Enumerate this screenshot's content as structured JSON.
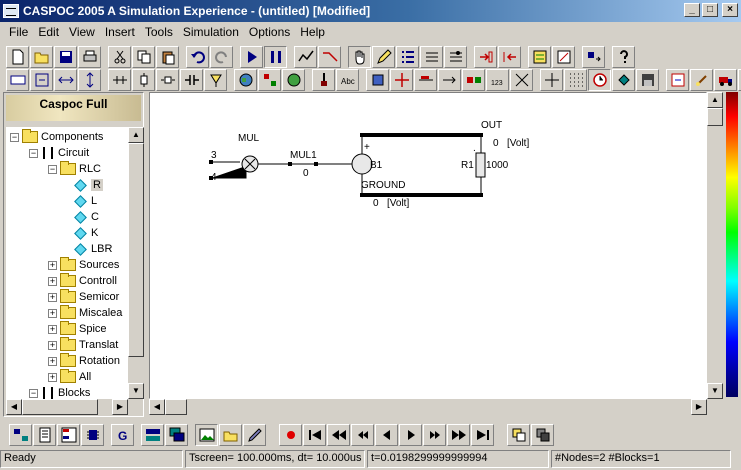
{
  "window": {
    "title": "CASPOC 2005 A Simulation Experience - (untitled) [Modified]",
    "minimize": "_",
    "maximize": "□",
    "close": "×"
  },
  "menu": [
    "File",
    "Edit",
    "View",
    "Insert",
    "Tools",
    "Simulation",
    "Options",
    "Help"
  ],
  "panel": {
    "title": "Caspoc Full"
  },
  "tree": [
    {
      "label": "Components",
      "level": 0,
      "toggle": "−",
      "icon": "folder"
    },
    {
      "label": "Circuit",
      "level": 1,
      "toggle": "−",
      "icon": "component"
    },
    {
      "label": "RLC",
      "level": 2,
      "toggle": "−",
      "icon": "folder"
    },
    {
      "label": "R",
      "level": 3,
      "toggle": "",
      "icon": "diamond"
    },
    {
      "label": "L",
      "level": 3,
      "toggle": "",
      "icon": "diamond"
    },
    {
      "label": "C",
      "level": 3,
      "toggle": "",
      "icon": "diamond"
    },
    {
      "label": "K",
      "level": 3,
      "toggle": "",
      "icon": "diamond"
    },
    {
      "label": "LBR",
      "level": 3,
      "toggle": "",
      "icon": "diamond"
    },
    {
      "label": "Sources",
      "level": 2,
      "toggle": "+",
      "icon": "folder"
    },
    {
      "label": "Controll",
      "level": 2,
      "toggle": "+",
      "icon": "folder"
    },
    {
      "label": "Semicor",
      "level": 2,
      "toggle": "+",
      "icon": "folder"
    },
    {
      "label": "Miscalea",
      "level": 2,
      "toggle": "+",
      "icon": "folder"
    },
    {
      "label": "Spice",
      "level": 2,
      "toggle": "+",
      "icon": "folder"
    },
    {
      "label": "Translat",
      "level": 2,
      "toggle": "+",
      "icon": "folder"
    },
    {
      "label": "Rotation",
      "level": 2,
      "toggle": "+",
      "icon": "folder"
    },
    {
      "label": "All",
      "level": 2,
      "toggle": "+",
      "icon": "folder"
    },
    {
      "label": "Blocks",
      "level": 1,
      "toggle": "−",
      "icon": "blocks"
    }
  ],
  "schematic": {
    "mul_label": "MUL",
    "input_a": "3",
    "input_b": "4",
    "mul_out_label": "MUL1",
    "mul_out_value": "0",
    "source_label": "B1",
    "plus": "+",
    "node_top_label": "OUT",
    "node_top_value": "0",
    "node_top_unit": "[Volt]",
    "node_bottom_label": "GROUND",
    "node_bottom_value": "0",
    "node_bottom_unit": "[Volt]",
    "resistor_label": "R1",
    "resistor_value": "1000",
    "dot": "."
  },
  "status": {
    "state": "Ready",
    "tscreen": "Tscreen= 100.000ms, dt= 10.000us",
    "time": "t=0.0198299999999994",
    "counts": "#Nodes=2 #Blocks=1"
  },
  "colors": {
    "title_start": "#0a246a",
    "title_end": "#a6caf0",
    "wire": "#000000"
  }
}
